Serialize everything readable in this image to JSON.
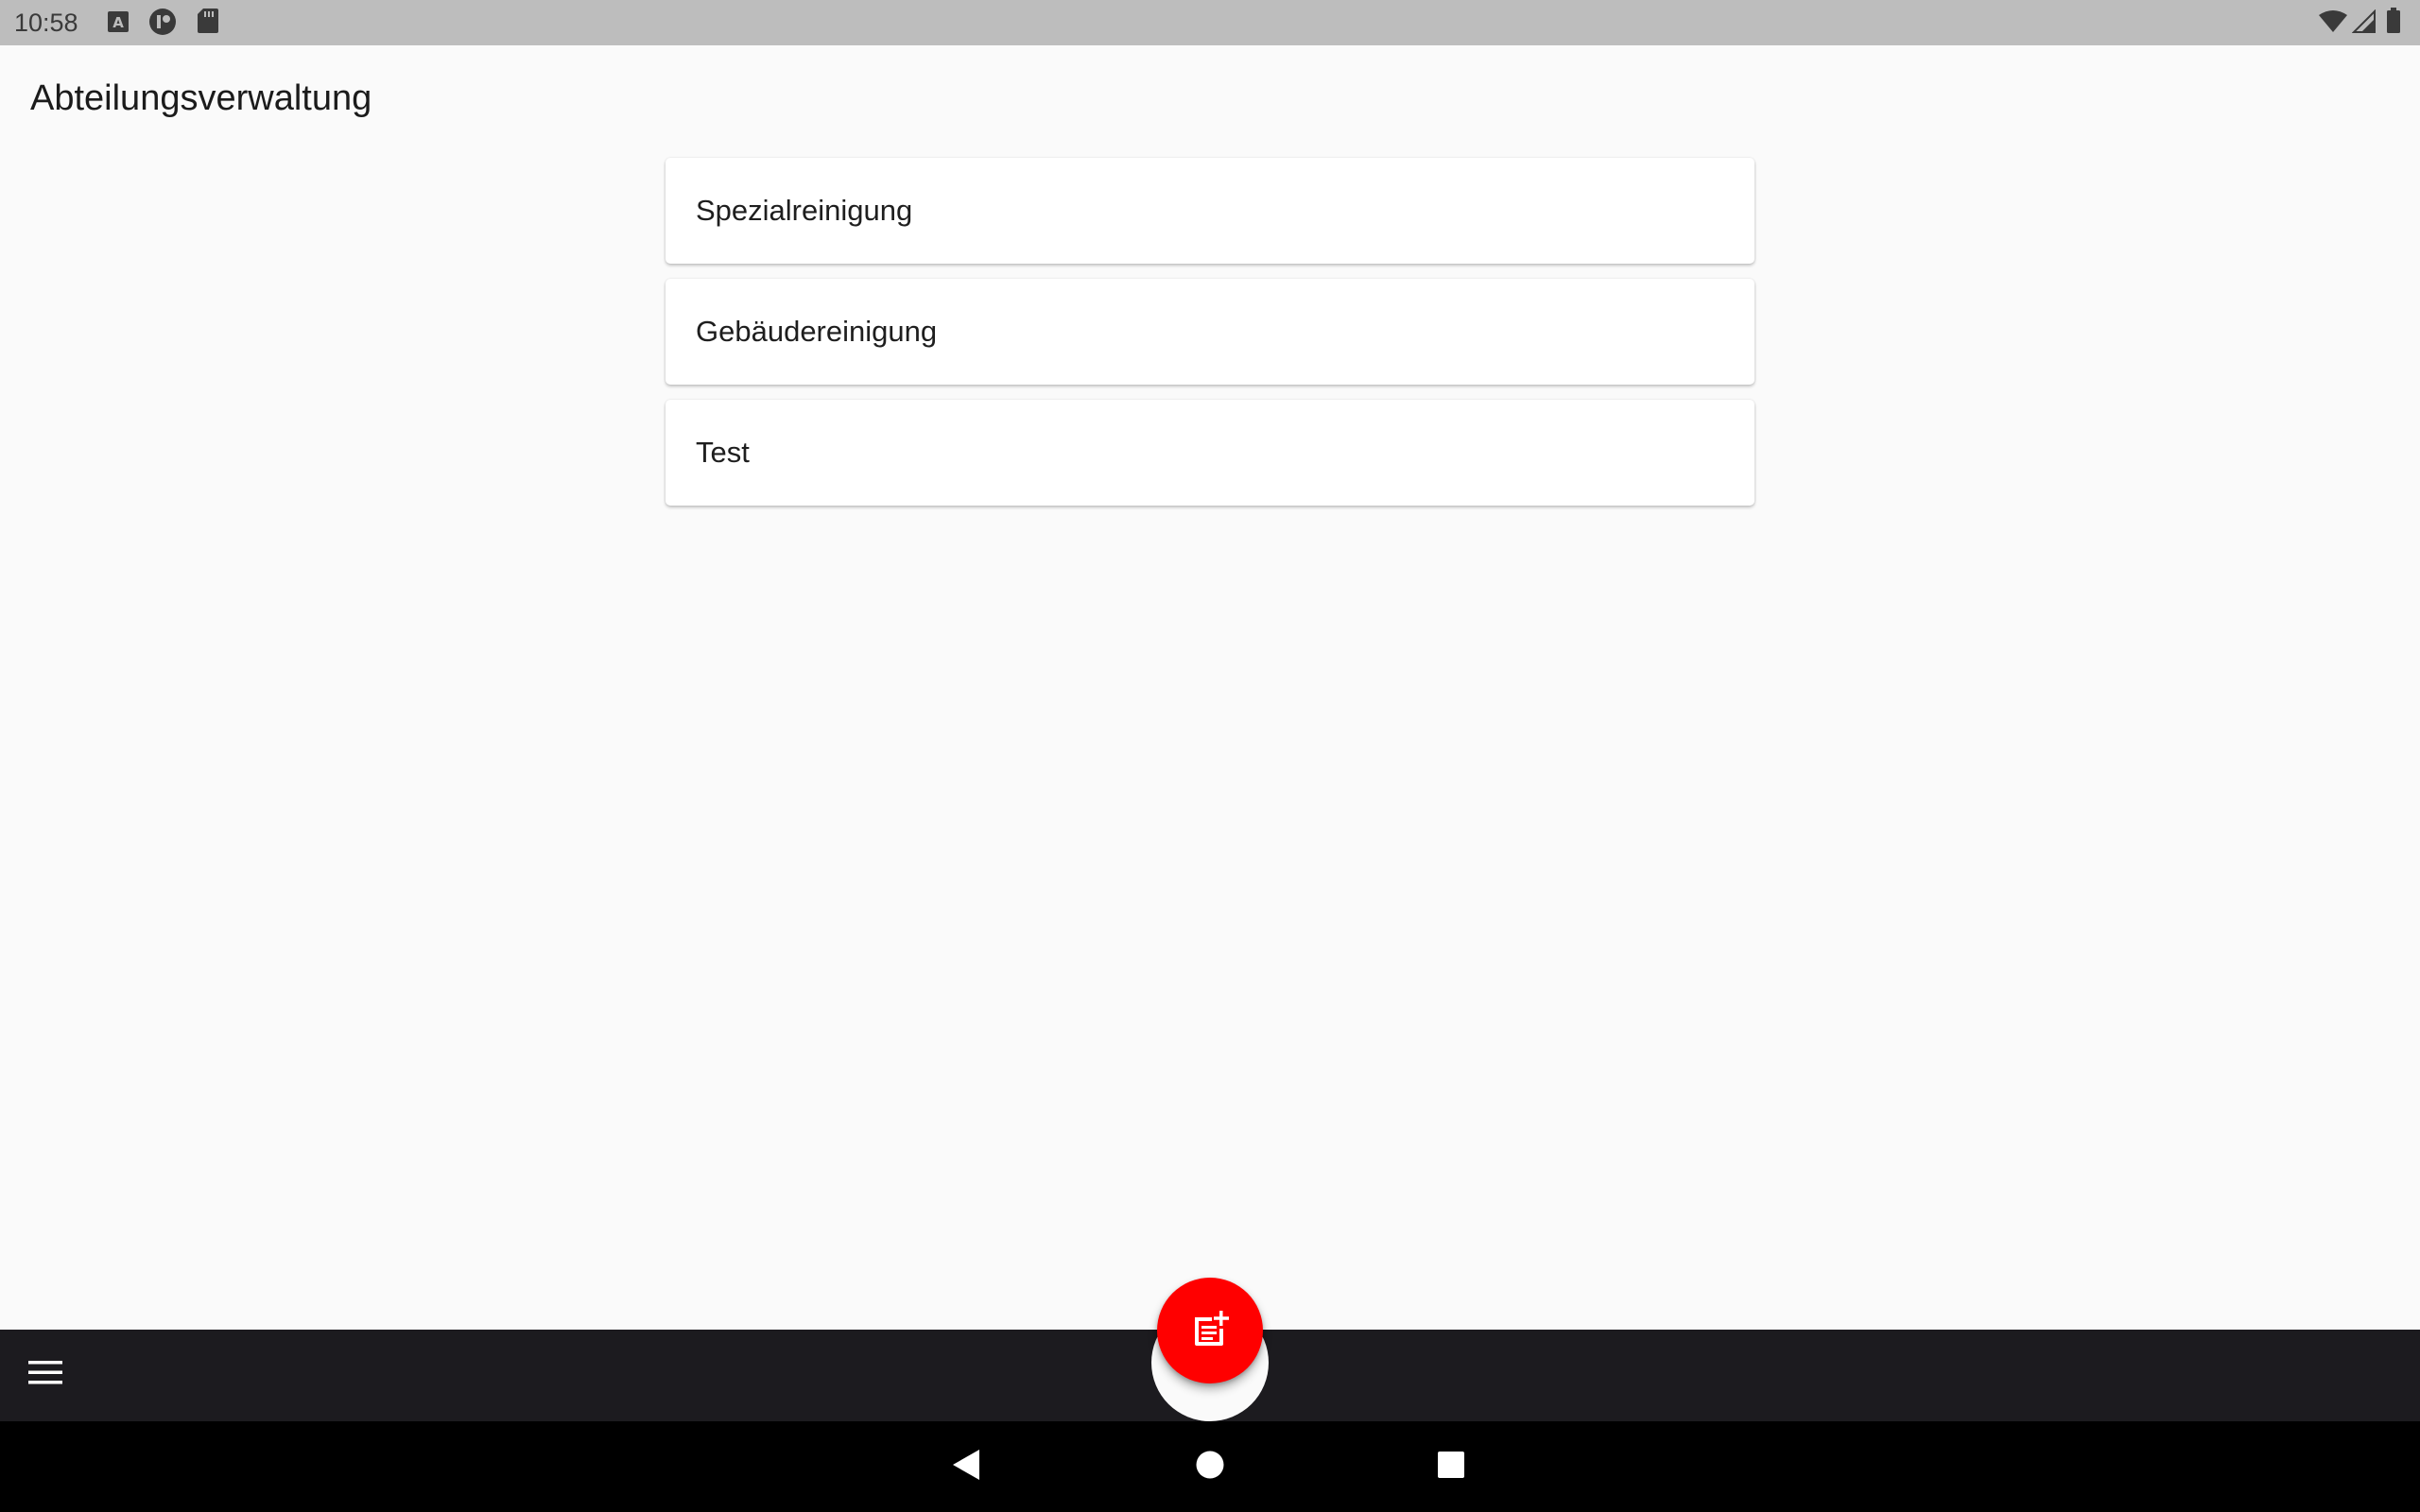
{
  "status_bar": {
    "time": "10:58",
    "icons": [
      "text-a-icon",
      "app-circle-icon",
      "sd-card-icon",
      "wifi-icon",
      "cell-signal-icon",
      "battery-icon"
    ]
  },
  "header": {
    "title": "Abteilungsverwaltung"
  },
  "departments": [
    {
      "label": "Spezialreinigung"
    },
    {
      "label": "Gebäudereinigung"
    },
    {
      "label": "Test"
    }
  ],
  "bottom_bar": {
    "menu_icon": "menu-icon",
    "fab_icon": "add-document-icon"
  },
  "nav_bar": {
    "icons": [
      "back-icon",
      "home-icon",
      "recents-icon"
    ]
  },
  "colors": {
    "background": "#fafafa",
    "status_bar": "#bdbdbd",
    "bottom_bar": "#1c1b1f",
    "fab": "#ff0000",
    "nav_bar": "#000000"
  }
}
